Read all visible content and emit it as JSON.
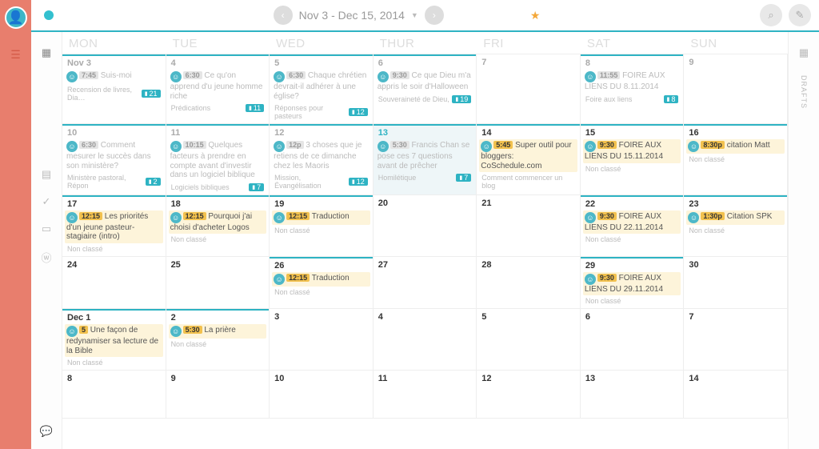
{
  "header": {
    "date_range": "Nov 3 - Dec 15, 2014",
    "prev_icon": "‹",
    "next_icon": "›",
    "star_icon": "★",
    "search_icon": "⌕",
    "edit_icon": "✎"
  },
  "dow": [
    "MON",
    "TUE",
    "WED",
    "THUR",
    "FRI",
    "SAT",
    "SUN"
  ],
  "right_rail": {
    "drafts_label": "DRAFTS"
  },
  "weeks": [
    {
      "days": [
        {
          "label": "Nov 3",
          "past": true,
          "topline": true,
          "events": [
            {
              "time": "7:45",
              "title": "Suis-moi"
            }
          ],
          "cat": "Recension de livres, Dia…",
          "badge": "21"
        },
        {
          "label": "4",
          "past": true,
          "topline": true,
          "events": [
            {
              "time": "6:30",
              "title": "Ce qu'on apprend d'u jeune homme riche"
            }
          ],
          "cat": "Prédications",
          "badge": "11"
        },
        {
          "label": "5",
          "past": true,
          "topline": true,
          "events": [
            {
              "time": "6:30",
              "title": "Chaque chrétien devrait-il adhérer à une église?"
            }
          ],
          "cat": "Réponses pour pasteurs",
          "badge": "12"
        },
        {
          "label": "6",
          "past": true,
          "topline": true,
          "events": [
            {
              "time": "9:30",
              "title": "Ce que Dieu m'a appris le soir d'Halloween"
            }
          ],
          "cat": "Souveraineté de Dieu,",
          "badge": "19"
        },
        {
          "label": "7",
          "past": true
        },
        {
          "label": "8",
          "past": true,
          "topline": true,
          "events": [
            {
              "time": "11:55",
              "title": "FOIRE AUX LIENS DU 8.11.2014"
            }
          ],
          "cat": "Foire aux liens",
          "badge": "8"
        },
        {
          "label": "9",
          "past": true
        }
      ]
    },
    {
      "days": [
        {
          "label": "10",
          "past": true,
          "topline": true,
          "events": [
            {
              "time": "6:30",
              "title": "Comment mesurer le succès dans son ministère?"
            }
          ],
          "cat": "Ministère pastoral, Répon",
          "badge": "2"
        },
        {
          "label": "11",
          "past": true,
          "topline": true,
          "events": [
            {
              "time": "10:15",
              "title": "Quelques facteurs à prendre en compte avant d'investir dans un logiciel biblique"
            }
          ],
          "cat": "Logiciels bibliques",
          "badge": "7"
        },
        {
          "label": "12",
          "past": true,
          "topline": true,
          "events": [
            {
              "time": "12p",
              "title": "3 choses que je retiens de ce dimanche chez les Maoris"
            }
          ],
          "cat": "Mission, Évangélisation",
          "badge": "12"
        },
        {
          "label": "13",
          "past": true,
          "today": true,
          "topline": true,
          "events": [
            {
              "time": "5:30",
              "title": "Francis Chan se pose ces 7 questions avant de prêcher"
            }
          ],
          "cat": "Homilétique",
          "badge": "7"
        },
        {
          "label": "14",
          "topline": true,
          "events": [
            {
              "time": "5:45",
              "title": "Super outil pour bloggers: CoSchedule.com",
              "yellow": true
            }
          ],
          "cat": "Comment commencer un blog"
        },
        {
          "label": "15",
          "topline": true,
          "events": [
            {
              "time": "9:30",
              "title": "FOIRE AUX LIENS DU 15.11.2014",
              "yellow": true
            }
          ],
          "cat": "Non classé"
        },
        {
          "label": "16",
          "topline": true,
          "events": [
            {
              "time": "8:30p",
              "title": "citation Matt",
              "yellow": true
            }
          ],
          "cat": "Non classé"
        }
      ]
    },
    {
      "days": [
        {
          "label": "17",
          "topline": true,
          "events": [
            {
              "time": "12:15",
              "title": "Les priorités d'un jeune pasteur-stagiaire (intro)",
              "yellow": true
            }
          ],
          "cat": "Non classé"
        },
        {
          "label": "18",
          "topline": true,
          "events": [
            {
              "time": "12:15",
              "title": "Pourquoi j'ai choisi d'acheter Logos",
              "yellow": true
            }
          ],
          "cat": "Non classé"
        },
        {
          "label": "19",
          "topline": true,
          "events": [
            {
              "time": "12:15",
              "title": "Traduction",
              "yellow": true
            }
          ],
          "cat": "Non classé"
        },
        {
          "label": "20"
        },
        {
          "label": "21"
        },
        {
          "label": "22",
          "topline": true,
          "events": [
            {
              "time": "9:30",
              "title": "FOIRE AUX LIENS DU 22.11.2014",
              "yellow": true
            }
          ],
          "cat": "Non classé"
        },
        {
          "label": "23",
          "topline": true,
          "events": [
            {
              "time": "1:30p",
              "title": "Citation SPK",
              "yellow": true
            }
          ],
          "cat": "Non classé"
        }
      ]
    },
    {
      "days": [
        {
          "label": "24"
        },
        {
          "label": "25"
        },
        {
          "label": "26",
          "topline": true,
          "events": [
            {
              "time": "12:15",
              "title": "Traduction",
              "yellow": true
            }
          ],
          "cat": "Non classé"
        },
        {
          "label": "27"
        },
        {
          "label": "28"
        },
        {
          "label": "29",
          "topline": true,
          "events": [
            {
              "time": "9:30",
              "title": "FOIRE AUX LIENS DU 29.11.2014",
              "yellow": true
            }
          ],
          "cat": "Non classé"
        },
        {
          "label": "30"
        }
      ]
    },
    {
      "days": [
        {
          "label": "Dec 1",
          "topline": true,
          "events": [
            {
              "time": "5",
              "title": "Une façon de redynamiser sa lecture de la Bible",
              "yellow": true
            }
          ],
          "cat": "Non classé"
        },
        {
          "label": "2",
          "topline": true,
          "events": [
            {
              "time": "5:30",
              "title": "La prière",
              "yellow": true
            }
          ],
          "cat": "Non classé"
        },
        {
          "label": "3"
        },
        {
          "label": "4"
        },
        {
          "label": "5"
        },
        {
          "label": "6"
        },
        {
          "label": "7"
        }
      ]
    },
    {
      "days": [
        {
          "label": "8"
        },
        {
          "label": "9"
        },
        {
          "label": "10"
        },
        {
          "label": "11"
        },
        {
          "label": "12"
        },
        {
          "label": "13"
        },
        {
          "label": "14"
        }
      ]
    }
  ]
}
